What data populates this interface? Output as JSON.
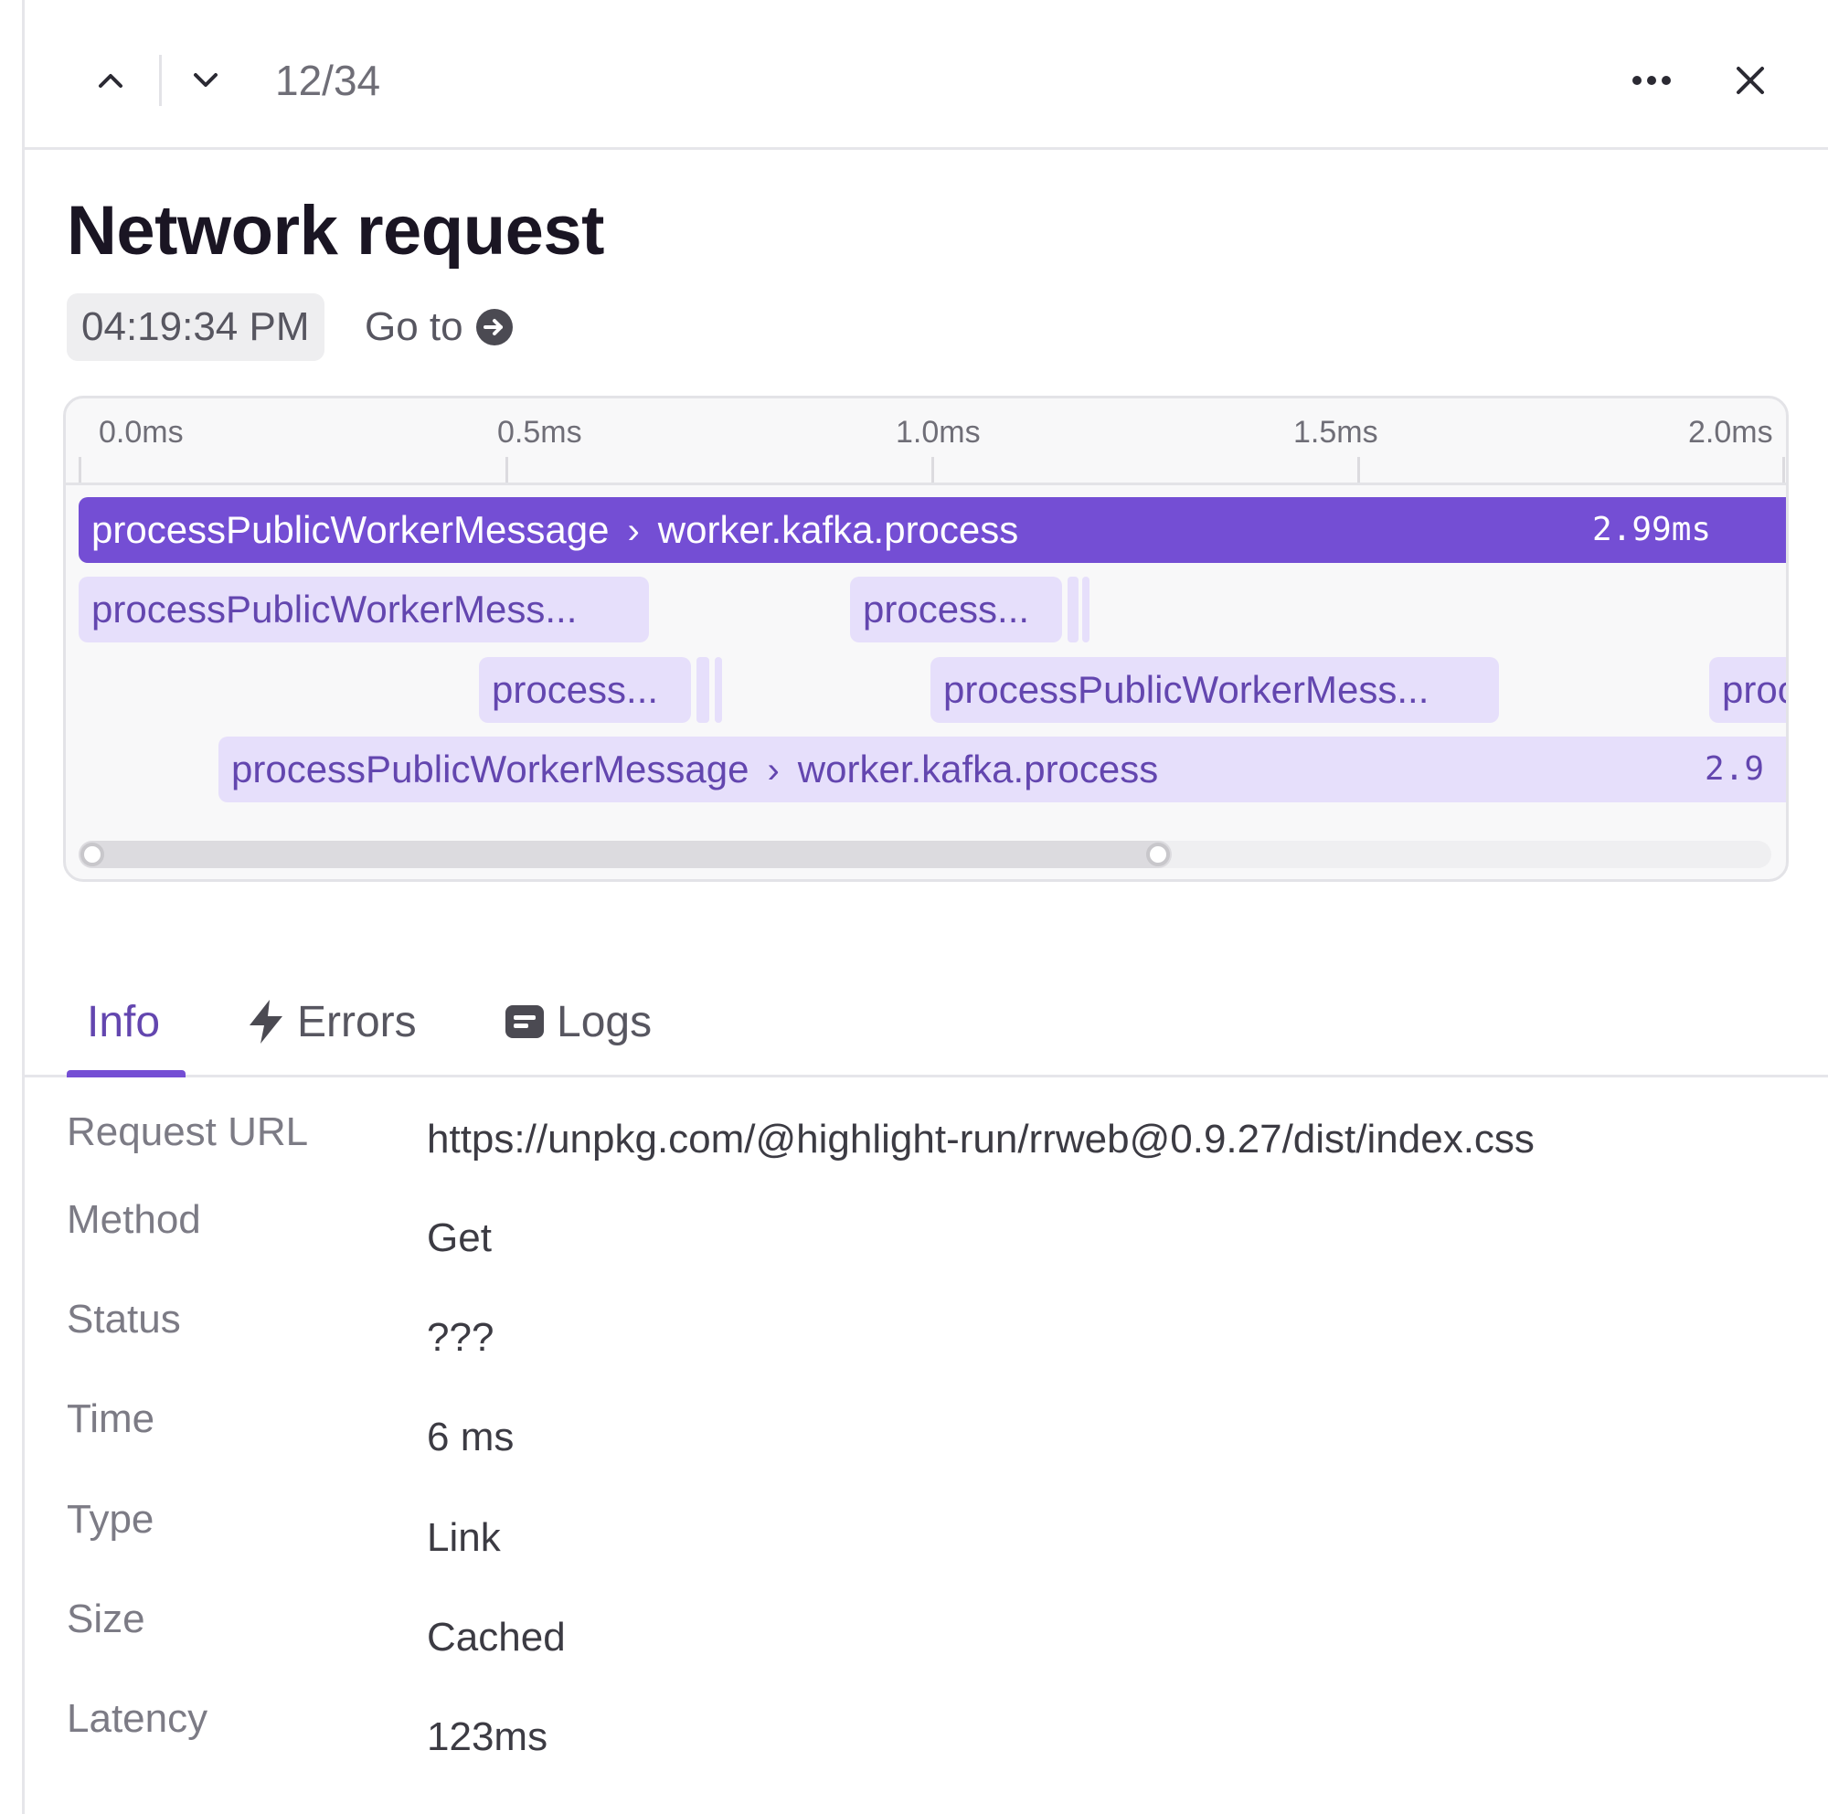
{
  "header": {
    "counter": "12/34"
  },
  "event": {
    "title": "Network request",
    "timestamp": "04:19:34 PM",
    "goto_label": "Go to"
  },
  "flame_graph": {
    "ticks": [
      "0.0ms",
      "0.5ms",
      "1.0ms",
      "1.5ms",
      "2.0ms"
    ],
    "bars": [
      {
        "name": "processPublicWorkerMessage",
        "child": "worker.kafka.process",
        "duration": "2.99ms",
        "active": true
      },
      {
        "name": "processPublicWorkerMess...",
        "child": "",
        "duration": "",
        "active": false
      },
      {
        "name": "process...",
        "child": "",
        "duration": "",
        "active": false
      },
      {
        "name": "process...",
        "child": "",
        "duration": "",
        "active": false
      },
      {
        "name": "processPublicWorkerMess...",
        "child": "",
        "duration": "",
        "active": false
      },
      {
        "name": "proc",
        "child": "",
        "duration": "",
        "active": false
      },
      {
        "name": "processPublicWorkerMessage",
        "child": "worker.kafka.process",
        "duration": "2.9",
        "active": false
      }
    ]
  },
  "tabs": [
    {
      "label": "Info",
      "icon": "",
      "active": true
    },
    {
      "label": "Errors",
      "icon": "lightning-icon",
      "active": false
    },
    {
      "label": "Logs",
      "icon": "log-icon",
      "active": false
    }
  ],
  "info": [
    {
      "label": "Request URL",
      "value": "https://unpkg.com/@highlight-run/rrweb@0.9.27/dist/index.css"
    },
    {
      "label": "Method",
      "value": "Get"
    },
    {
      "label": "Status",
      "value": "???"
    },
    {
      "label": "Time",
      "value": "6 ms"
    },
    {
      "label": "Type",
      "value": "Link"
    },
    {
      "label": "Size",
      "value": "Cached"
    },
    {
      "label": "Latency",
      "value": "123ms"
    }
  ],
  "colors": {
    "accent": "#744ed4",
    "accent_light": "#e6dffb",
    "accent_text": "#6346af"
  }
}
